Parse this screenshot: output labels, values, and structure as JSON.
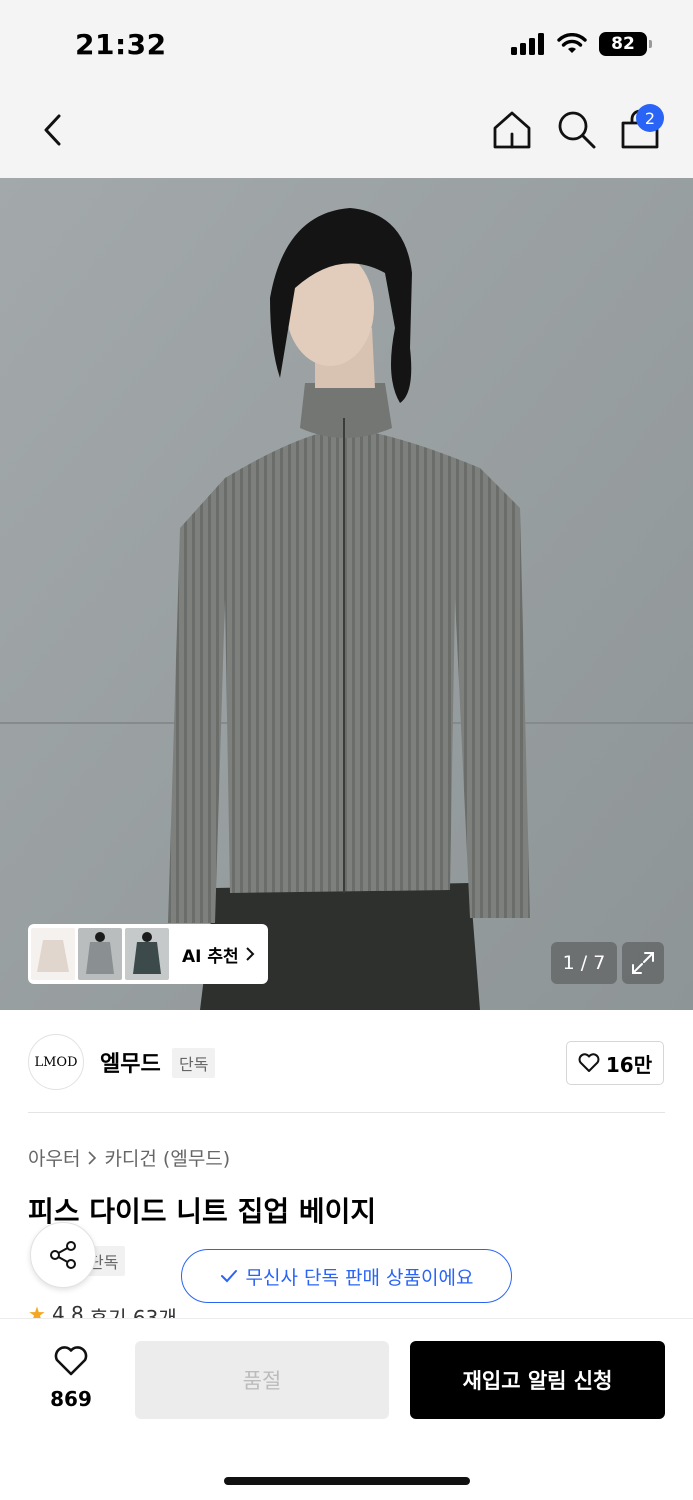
{
  "status_bar": {
    "time": "21:32",
    "battery": "82",
    "icons": [
      "signal-icon",
      "wifi-icon",
      "battery-icon"
    ]
  },
  "nav": {
    "icons": [
      "back-chevron-icon",
      "home-icon",
      "search-icon",
      "cart-icon"
    ],
    "cart_badge": "2"
  },
  "gallery": {
    "ai_label": "AI 추천",
    "pager": "1 / 7",
    "thumb_colors": [
      "#e0d6cd",
      "#8a9092",
      "#3d4a4c"
    ]
  },
  "brand": {
    "logo_text": "LMOD",
    "name": "엘무드",
    "tag": "단독",
    "like_count": "16만"
  },
  "product": {
    "breadcrumb": [
      "아우터",
      "카디건 (엘무드)"
    ],
    "title": "피스 다이드 니트 집업 베이지",
    "exclusive_tag": "단독",
    "exclusive_notice": "무신사 단독 판매 상품이에요",
    "rating": "4.8",
    "reviews": "후기 63개"
  },
  "bottom_bar": {
    "wish_count": "869",
    "soldout_label": "품절",
    "restock_label": "재입고 알림 신청"
  },
  "colors": {
    "accent": "#2a64f6",
    "primary_button": "#000000",
    "disabled_button": "#ececec"
  }
}
